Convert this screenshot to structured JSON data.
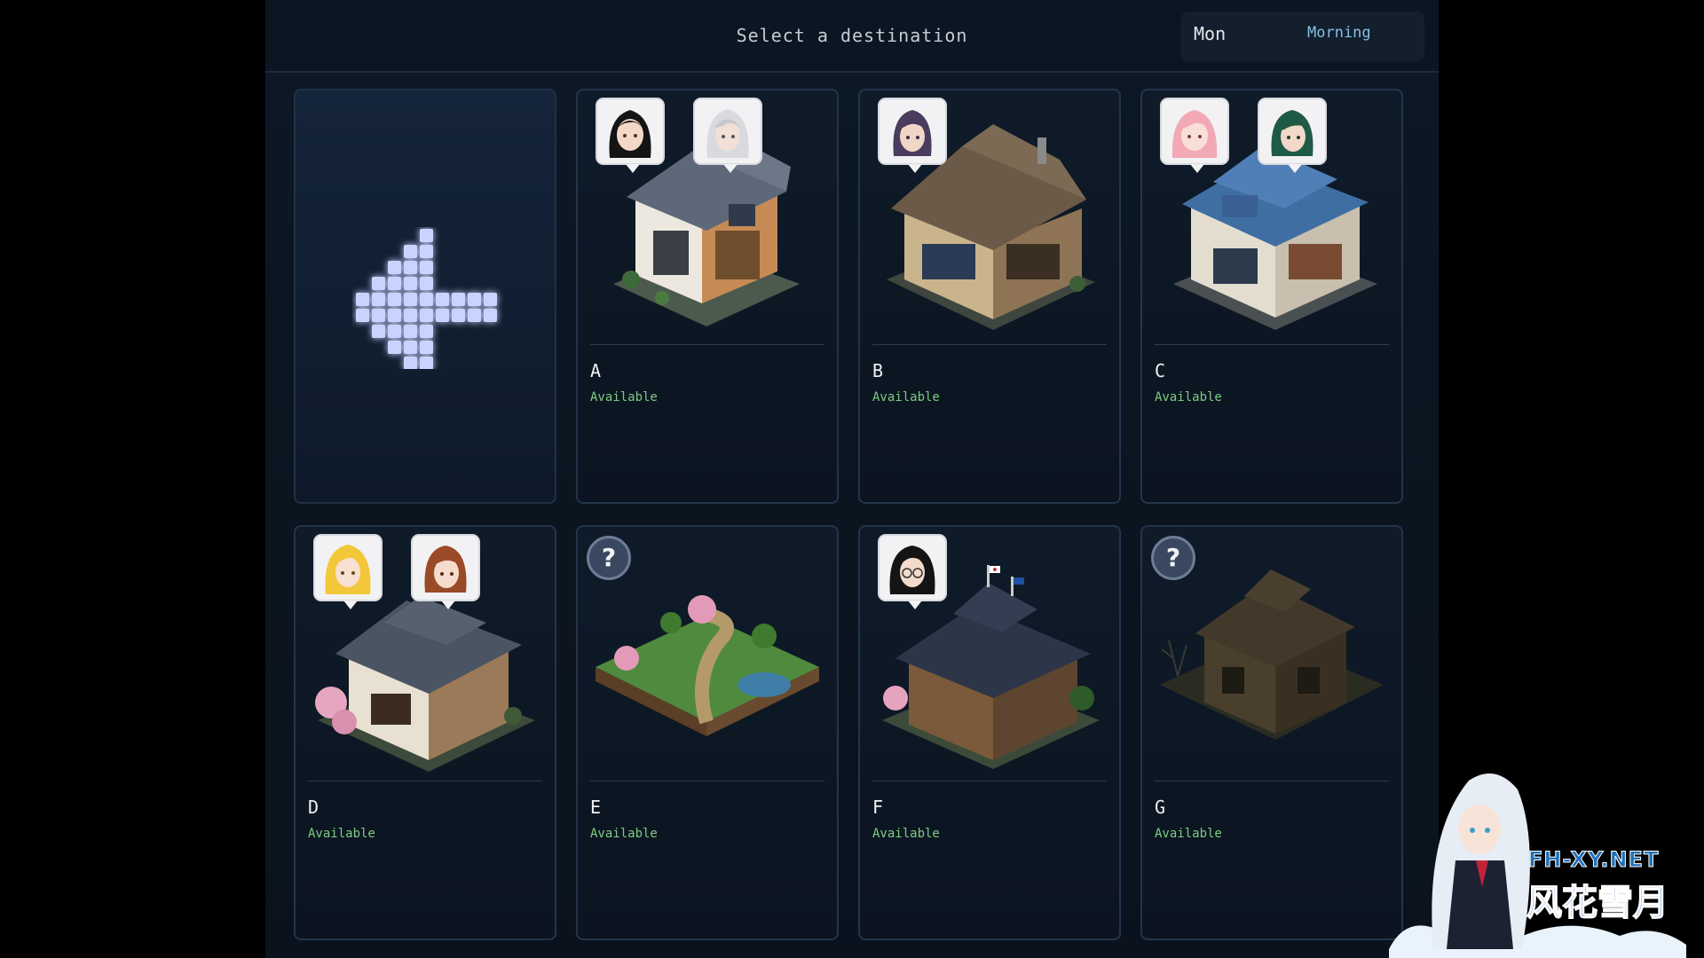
{
  "header": {
    "title": "Select a destination",
    "day": "Mon",
    "period": "Morning"
  },
  "back_button": {
    "icon": "left-arrow-icon"
  },
  "locations": [
    {
      "id": "A",
      "label": "A",
      "status": "Available",
      "portraits": [
        "dark-haired-woman",
        "white-haired-woman"
      ],
      "building": "modern-two-story-house",
      "known": true
    },
    {
      "id": "B",
      "label": "B",
      "status": "Available",
      "portraits": [
        "purple-haired-woman"
      ],
      "building": "traditional-shop",
      "known": true
    },
    {
      "id": "C",
      "label": "C",
      "status": "Available",
      "portraits": [
        "pink-haired-girl",
        "green-haired-woman"
      ],
      "building": "blue-roof-pharmacy",
      "known": true
    },
    {
      "id": "D",
      "label": "D",
      "status": "Available",
      "portraits": [
        "blonde-girl",
        "brown-haired-girl"
      ],
      "building": "japanese-house",
      "known": true
    },
    {
      "id": "E",
      "label": "E",
      "status": "Available",
      "portraits": [],
      "building": "park",
      "known": false
    },
    {
      "id": "F",
      "label": "F",
      "status": "Available",
      "portraits": [
        "woman-with-glasses"
      ],
      "building": "school-building",
      "known": true
    },
    {
      "id": "G",
      "label": "G",
      "status": "Available",
      "portraits": [],
      "building": "abandoned-house",
      "known": false
    }
  ],
  "watermark": {
    "site": "FH-XY.NET",
    "name": "风花雪月"
  },
  "colors": {
    "available": "#7ecb82",
    "accent": "#86bfe6",
    "card_border": "#22354b"
  }
}
